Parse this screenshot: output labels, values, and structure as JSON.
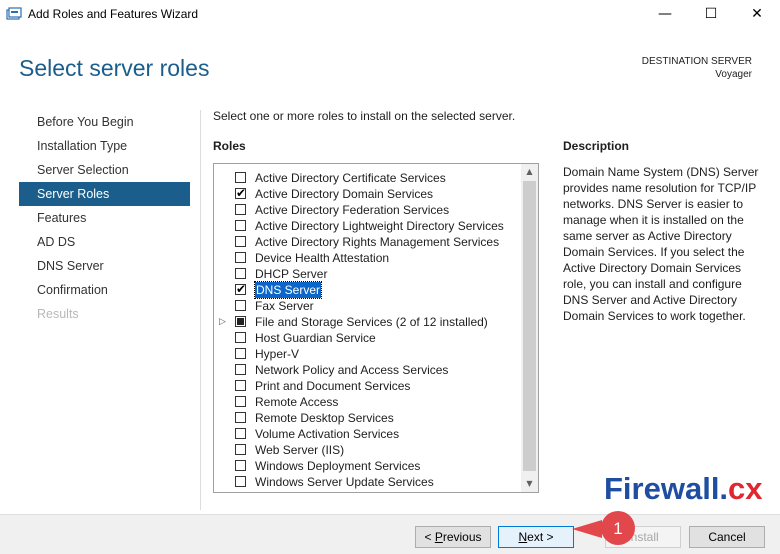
{
  "window": {
    "title": "Add Roles and Features Wizard",
    "controls": [
      "minimize-icon",
      "maximize-icon",
      "close-icon"
    ]
  },
  "header": {
    "page_title": "Select server roles",
    "destination_label": "DESTINATION SERVER",
    "destination_server": "Voyager"
  },
  "nav": {
    "items": [
      {
        "label": "Before You Begin",
        "state": "normal"
      },
      {
        "label": "Installation Type",
        "state": "normal"
      },
      {
        "label": "Server Selection",
        "state": "normal"
      },
      {
        "label": "Server Roles",
        "state": "active"
      },
      {
        "label": "Features",
        "state": "normal"
      },
      {
        "label": "AD DS",
        "state": "normal"
      },
      {
        "label": "DNS Server",
        "state": "normal"
      },
      {
        "label": "Confirmation",
        "state": "normal"
      },
      {
        "label": "Results",
        "state": "disabled"
      }
    ]
  },
  "main": {
    "intro": "Select one or more roles to install on the selected server.",
    "roles_heading": "Roles",
    "roles": [
      {
        "label": "Active Directory Certificate Services",
        "state": "unchecked"
      },
      {
        "label": "Active Directory Domain Services",
        "state": "checked"
      },
      {
        "label": "Active Directory Federation Services",
        "state": "unchecked"
      },
      {
        "label": "Active Directory Lightweight Directory Services",
        "state": "unchecked"
      },
      {
        "label": "Active Directory Rights Management Services",
        "state": "unchecked"
      },
      {
        "label": "Device Health Attestation",
        "state": "unchecked"
      },
      {
        "label": "DHCP Server",
        "state": "unchecked"
      },
      {
        "label": "DNS Server",
        "state": "checked",
        "selected": true
      },
      {
        "label": "Fax Server",
        "state": "unchecked"
      },
      {
        "label": "File and Storage Services (2 of 12 installed)",
        "state": "partial",
        "expandable": true
      },
      {
        "label": "Host Guardian Service",
        "state": "unchecked"
      },
      {
        "label": "Hyper-V",
        "state": "unchecked"
      },
      {
        "label": "Network Policy and Access Services",
        "state": "unchecked"
      },
      {
        "label": "Print and Document Services",
        "state": "unchecked"
      },
      {
        "label": "Remote Access",
        "state": "unchecked"
      },
      {
        "label": "Remote Desktop Services",
        "state": "unchecked"
      },
      {
        "label": "Volume Activation Services",
        "state": "unchecked"
      },
      {
        "label": "Web Server (IIS)",
        "state": "unchecked"
      },
      {
        "label": "Windows Deployment Services",
        "state": "unchecked"
      },
      {
        "label": "Windows Server Update Services",
        "state": "unchecked"
      }
    ],
    "description_heading": "Description",
    "description": "Domain Name System (DNS) Server provides name resolution for TCP/IP networks. DNS Server is easier to manage when it is installed on the same server as Active Directory Domain Services. If you select the Active Directory Domain Services role, you can install and configure DNS Server and Active Directory Domain Services to work together."
  },
  "footer": {
    "previous_label": "< Previous",
    "next_label": "Next >",
    "install_label": "Install",
    "cancel_label": "Cancel"
  },
  "annotation": {
    "callout_number": "1",
    "callout_color": "#e2474b"
  },
  "watermark": {
    "text_main": "Firewall.",
    "text_accent": "cx"
  },
  "colors": {
    "accent": "#1b5e8c",
    "selection": "#0c66c9",
    "next_border": "#0078d7"
  }
}
